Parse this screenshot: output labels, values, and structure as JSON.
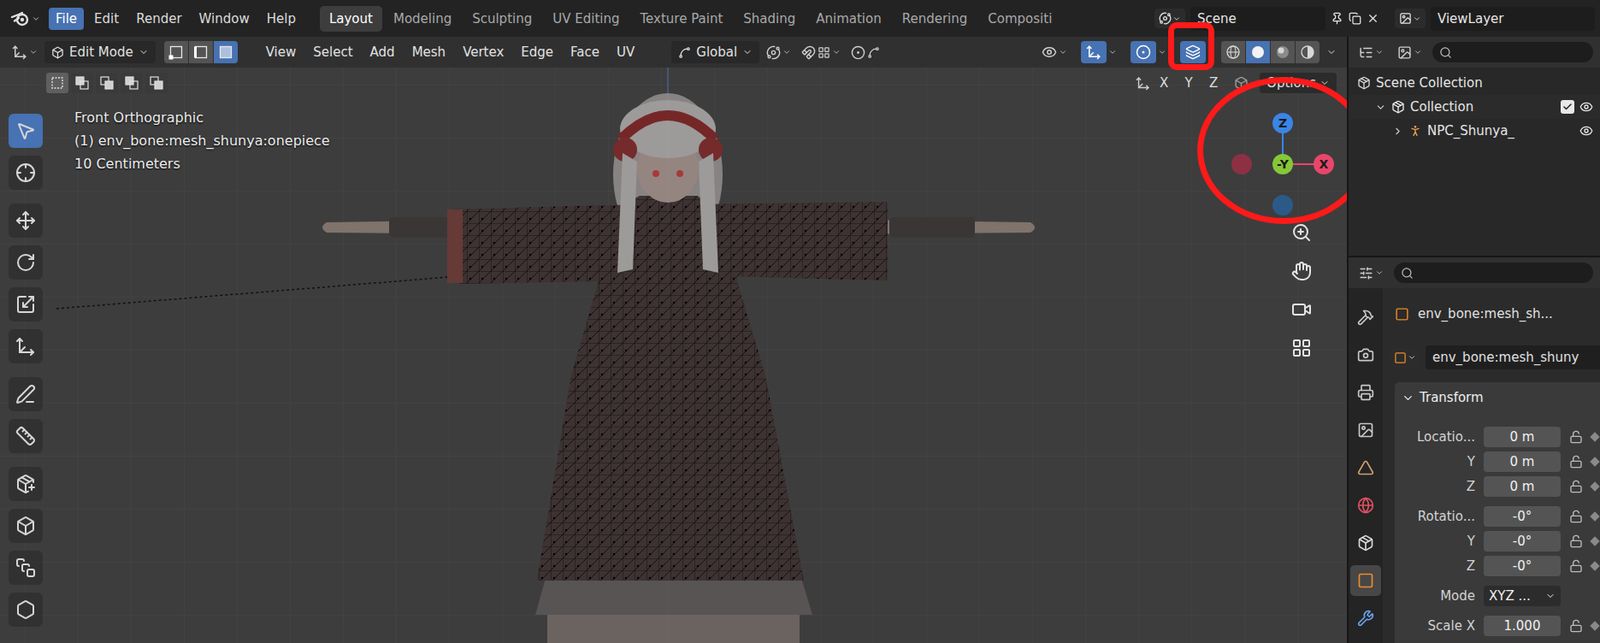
{
  "top_bar": {
    "menus": [
      {
        "label": "File",
        "selected": true
      },
      {
        "label": "Edit",
        "selected": false
      },
      {
        "label": "Render",
        "selected": false
      },
      {
        "label": "Window",
        "selected": false
      },
      {
        "label": "Help",
        "selected": false
      }
    ],
    "workspaces": [
      {
        "label": "Layout",
        "selected": true
      },
      {
        "label": "Modeling",
        "selected": false
      },
      {
        "label": "Sculpting",
        "selected": false
      },
      {
        "label": "UV Editing",
        "selected": false
      },
      {
        "label": "Texture Paint",
        "selected": false
      },
      {
        "label": "Shading",
        "selected": false
      },
      {
        "label": "Animation",
        "selected": false
      },
      {
        "label": "Rendering",
        "selected": false
      },
      {
        "label": "Compositi",
        "selected": false
      }
    ],
    "scene": "Scene",
    "view_layer": "ViewLayer"
  },
  "viewport_header": {
    "mode": "Edit Mode",
    "select_modes": [
      {
        "kind": "vertex",
        "selected": false
      },
      {
        "kind": "edge",
        "selected": false
      },
      {
        "kind": "face",
        "selected": true
      }
    ],
    "menus": [
      "View",
      "Select",
      "Add",
      "Mesh",
      "Vertex",
      "Edge",
      "Face",
      "UV"
    ],
    "orientation": "Global",
    "toggles": [
      {
        "kind": "gizmos",
        "on": true
      },
      {
        "kind": "overlays",
        "on": true
      },
      {
        "kind": "xray",
        "on": true
      }
    ],
    "shading": [
      {
        "kind": "wireframe",
        "selected": false
      },
      {
        "kind": "solid",
        "selected": true
      },
      {
        "kind": "material",
        "selected": false
      },
      {
        "kind": "rendered",
        "selected": false
      }
    ]
  },
  "tool_settings": {
    "box_modes": [
      {
        "kind": "set",
        "selected": true
      },
      {
        "kind": "extend",
        "selected": false
      },
      {
        "kind": "subtract",
        "selected": false
      },
      {
        "kind": "invert",
        "selected": false
      },
      {
        "kind": "intersect",
        "selected": false
      }
    ],
    "axes": [
      "X",
      "Y",
      "Z"
    ],
    "options": "Options"
  },
  "viewport": {
    "info": [
      "Front Orthographic",
      "(1) env_bone:mesh_shunya:onepiece",
      "10 Centimeters"
    ],
    "tool_groups": [
      [
        {
          "kind": "select",
          "selected": true
        },
        {
          "kind": "cursor",
          "selected": false
        }
      ],
      [
        {
          "kind": "move",
          "selected": false
        },
        {
          "kind": "rotate",
          "selected": false
        },
        {
          "kind": "scale",
          "selected": false
        },
        {
          "kind": "transform",
          "selected": false
        }
      ],
      [
        {
          "kind": "annotate",
          "selected": false
        },
        {
          "kind": "measure",
          "selected": false
        }
      ],
      [
        {
          "kind": "add-cube",
          "selected": false
        },
        {
          "kind": "extrude",
          "selected": false
        },
        {
          "kind": "inset",
          "selected": false
        },
        {
          "kind": "bevel",
          "selected": false
        }
      ]
    ],
    "gizmo": [
      {
        "axis": "z+",
        "label": "Z",
        "color": "#3a85e6"
      },
      {
        "axis": "x-",
        "label": "",
        "color": "#8e3044"
      },
      {
        "axis": "z-",
        "label": "",
        "color": "#2c5a88"
      },
      {
        "axis": "x+",
        "label": "X",
        "color": "#e8466a"
      },
      {
        "axis": "y-",
        "label": "-Y",
        "color": "#86c738"
      }
    ],
    "nav": [
      "zoom",
      "pan",
      "camera",
      "grid"
    ]
  },
  "annotations": [
    {
      "target": "xray-toggle"
    },
    {
      "target": "navigation-gizmo"
    }
  ],
  "outliner": {
    "items": [
      {
        "label": "Scene Collection",
        "kind": "scene",
        "depth": 0
      },
      {
        "label": "Collection",
        "kind": "collection",
        "depth": 1,
        "expanded": true,
        "checked": true,
        "visible": true
      },
      {
        "label": "NPC_Shunya_",
        "kind": "armature",
        "depth": 2,
        "expanded": false,
        "visible": true
      }
    ]
  },
  "properties": {
    "tabs": [
      {
        "kind": "tool",
        "selected": false
      },
      {
        "kind": "render",
        "selected": false
      },
      {
        "kind": "output",
        "selected": false
      },
      {
        "kind": "view-layer",
        "selected": false
      },
      {
        "kind": "scene",
        "selected": false
      },
      {
        "kind": "world",
        "selected": false
      },
      {
        "kind": "collection",
        "selected": false
      },
      {
        "kind": "object",
        "selected": true
      },
      {
        "kind": "modifiers",
        "selected": false
      }
    ],
    "object_name": "env_bone:mesh_sh...",
    "data_name": "env_bone:mesh_shuny",
    "panel": {
      "title": "Transform",
      "expanded": true,
      "groups": [
        [
          {
            "label": "Locatio...",
            "value": "0 m",
            "kind": "number"
          },
          {
            "label": "Y",
            "value": "0 m",
            "kind": "number"
          },
          {
            "label": "Z",
            "value": "0 m",
            "kind": "number"
          }
        ],
        [
          {
            "label": "Rotatio...",
            "value": "-0°",
            "kind": "number"
          },
          {
            "label": "Y",
            "value": "-0°",
            "kind": "number"
          },
          {
            "label": "Z",
            "value": "-0°",
            "kind": "number"
          }
        ],
        [
          {
            "label": "Mode",
            "value": "XYZ ...",
            "kind": "dropdown"
          }
        ],
        [
          {
            "label": "Scale X",
            "value": "1.000",
            "kind": "number"
          }
        ]
      ]
    }
  }
}
